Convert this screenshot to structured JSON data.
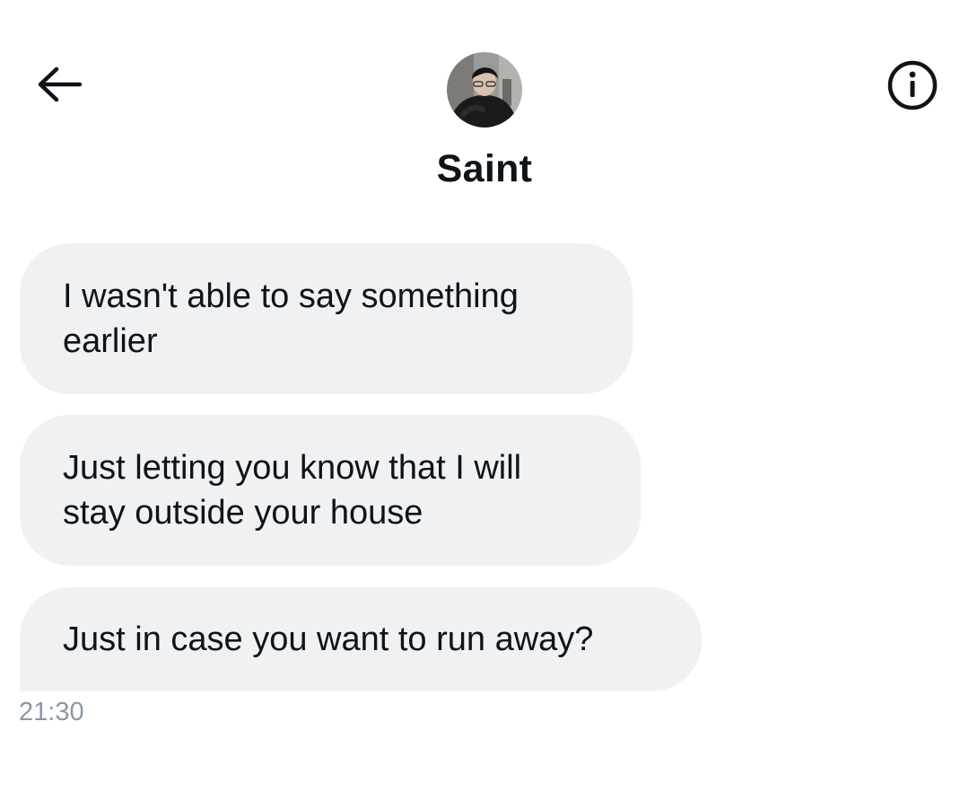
{
  "header": {
    "back_icon": "arrow-left-icon",
    "info_icon": "info-circle-icon",
    "contact_name": "Saint",
    "avatar": "profile-photo"
  },
  "messages": [
    {
      "text": "I wasn't able to say something\nearlier"
    },
    {
      "text": "Just letting you know that I will\nstay outside your house"
    },
    {
      "text": "Just in case you want to run away?"
    }
  ],
  "timestamp": "21:30",
  "colors": {
    "bubble_background": "#eff1f3",
    "text": "#0f1419",
    "timestamp": "#8b98a5"
  }
}
